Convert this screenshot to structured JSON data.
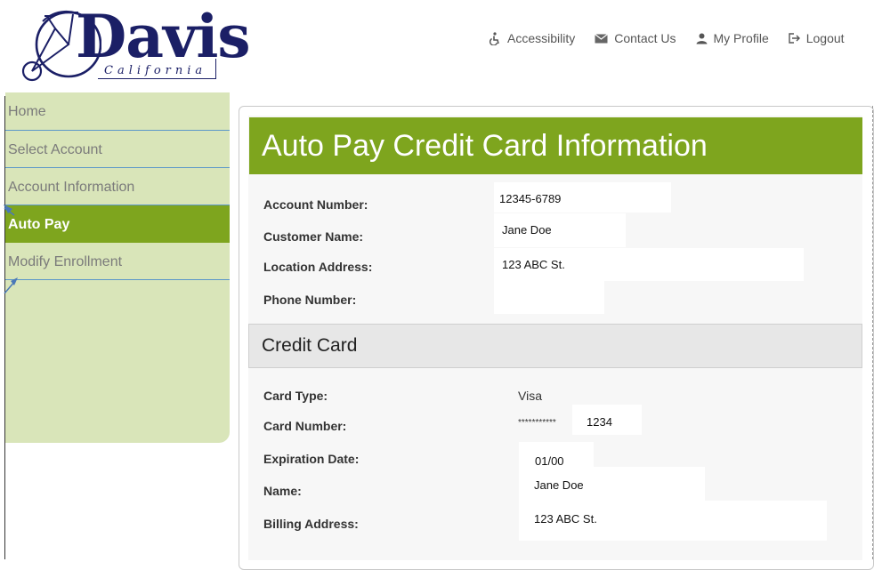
{
  "logo": {
    "title": "Davis",
    "subtitle": "California"
  },
  "topnav": [
    {
      "label": "Accessibility",
      "icon": "accessibility-icon"
    },
    {
      "label": "Contact Us",
      "icon": "envelope-icon"
    },
    {
      "label": "My Profile",
      "icon": "user-icon"
    },
    {
      "label": "Logout",
      "icon": "logout-icon"
    }
  ],
  "sidebar": {
    "items": [
      {
        "label": "Home"
      },
      {
        "label": "Select Account"
      },
      {
        "label": "Account Information"
      },
      {
        "label": "Auto Pay",
        "active": true
      },
      {
        "label": "Modify Enrollment"
      }
    ]
  },
  "page": {
    "title": "Auto Pay Credit Card Information"
  },
  "account": {
    "account_number_label": "Account Number:",
    "account_number": "12345-6789",
    "customer_name_label": "Customer Name:",
    "customer_name": "Jane Doe",
    "location_address_label": "Location Address:",
    "location_address": "123 ABC St.",
    "phone_number_label": "Phone Number:",
    "phone_number": ""
  },
  "credit_card": {
    "heading": "Credit Card",
    "card_type_label": "Card Type:",
    "card_type": "Visa",
    "card_number_label": "Card Number:",
    "card_number_mask": "***********",
    "card_number_last4": "1234",
    "expiration_label": "Expiration Date:",
    "expiration": "01/00",
    "name_label": "Name:",
    "name": "Jane Doe",
    "billing_address_label": "Billing Address:",
    "billing_address": "123 ABC St."
  },
  "colors": {
    "accent_green": "#7ea51e",
    "sidebar_bg": "#d9e5b9",
    "brand_navy": "#1b1f66",
    "divider_blue": "#5b97c9"
  }
}
